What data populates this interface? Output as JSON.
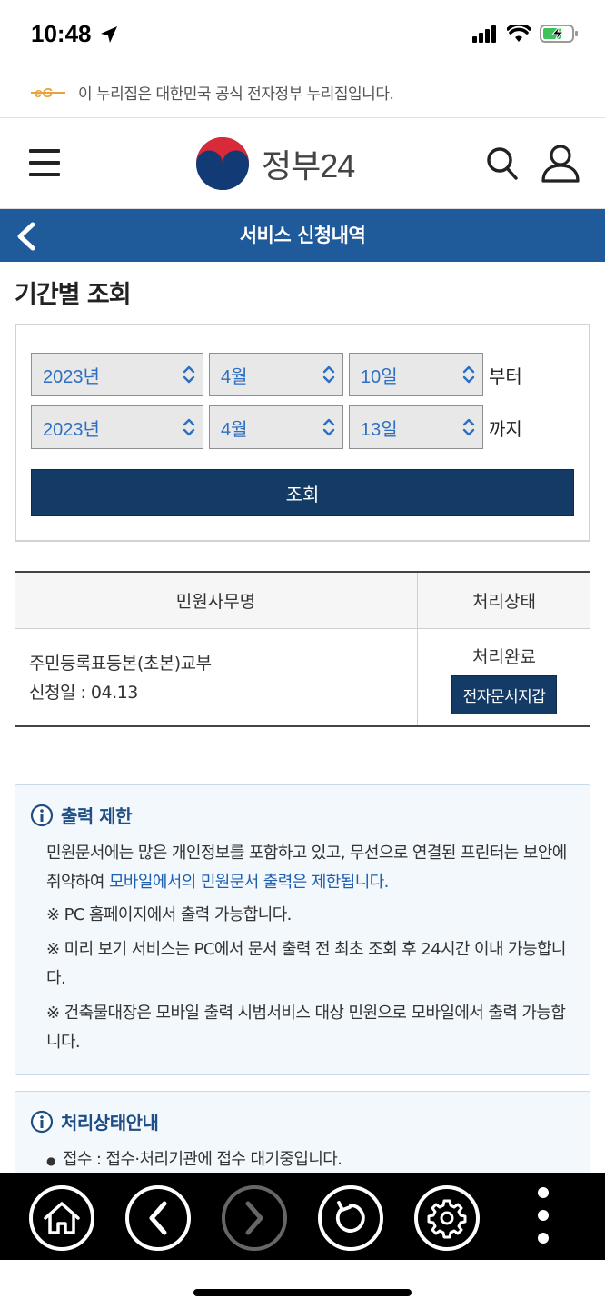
{
  "status_bar": {
    "time": "10:48"
  },
  "gov_banner": {
    "text": "이 누리집은 대한민국 공식 전자정부 누리집입니다."
  },
  "header": {
    "logo_text": "정부24"
  },
  "title_bar": {
    "title": "서비스 신청내역"
  },
  "section": {
    "title": "기간별 조회"
  },
  "filter": {
    "from": {
      "year": "2023년",
      "month": "4월",
      "day": "10일",
      "suffix": "부터"
    },
    "to": {
      "year": "2023년",
      "month": "4월",
      "day": "13일",
      "suffix": "까지"
    },
    "query_label": "조회"
  },
  "table": {
    "headers": [
      "민원사무명",
      "처리상태"
    ],
    "rows": [
      {
        "name": "주민등록표등본(초본)교부",
        "date": "신청일 : 04.13",
        "status": "처리완료",
        "action": "전자문서지갑"
      }
    ]
  },
  "notice_print": {
    "title": "출력 제한",
    "p1_a": "민원문서에는 많은 개인정보를 포함하고 있고, 무선으로 연결된 프린터는 보안에 취약하여 ",
    "p1_b": "모바일에서의 민원문서 출력은 제한됩니다.",
    "p2": "※ PC 홈페이지에서 출력 가능합니다.",
    "p3": "※ 미리 보기 서비스는 PC에서 문서 출력 전 최초 조회 후 24시간 이내 가능합니다.",
    "p4": "※ 건축물대장은 모바일 출력 시범서비스 대상 민원으로 모바일에서 출력 가능합니다."
  },
  "notice_status": {
    "title": "처리상태안내",
    "item1": "접수 : 접수·처리기관에 접수 대기중입니다."
  },
  "colors": {
    "primary": "#1f5a9a",
    "button": "#143a66",
    "link": "#1f5fb3"
  }
}
